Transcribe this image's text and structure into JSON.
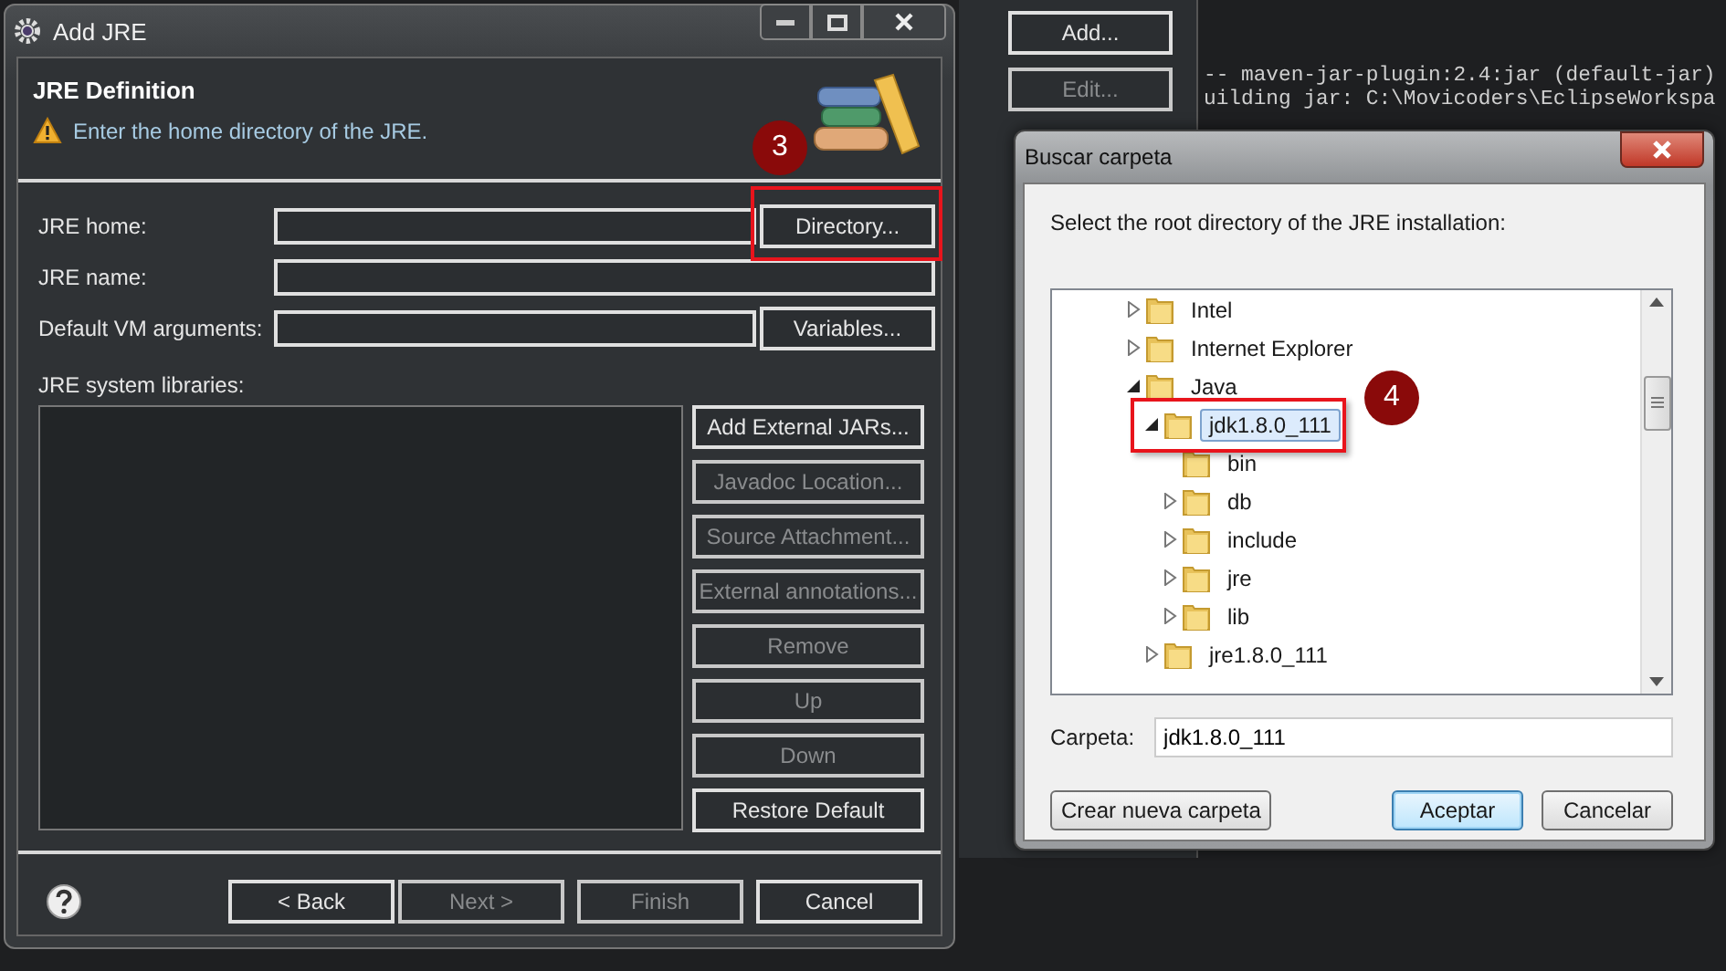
{
  "background": {
    "buttons": [
      {
        "label": "Add...",
        "disabled": false
      },
      {
        "label": "Edit...",
        "disabled": true
      }
    ],
    "console_lines": [
      "-- maven-jar-plugin:2.4:jar (default-jar)",
      "uilding jar: C:\\Movicoders\\EclipseWorkspa"
    ]
  },
  "add_jre": {
    "title": "Add JRE",
    "header_title": "JRE Definition",
    "message": "Enter the home directory of the JRE.",
    "fields": [
      {
        "label": "JRE home:",
        "button": "Directory..."
      },
      {
        "label": "JRE name:"
      },
      {
        "label": "Default VM arguments:",
        "button": "Variables..."
      }
    ],
    "libraries_label": "JRE system libraries:",
    "library_buttons": [
      {
        "label": "Add External JARs...",
        "disabled": false
      },
      {
        "label": "Javadoc Location...",
        "disabled": true
      },
      {
        "label": "Source Attachment...",
        "disabled": true
      },
      {
        "label": "External annotations...",
        "disabled": true
      },
      {
        "label": "Remove",
        "disabled": true
      },
      {
        "label": "Up",
        "disabled": true
      },
      {
        "label": "Down",
        "disabled": true
      },
      {
        "label": "Restore Default",
        "disabled": false
      }
    ],
    "footer_buttons": [
      {
        "label": "< Back",
        "disabled": false
      },
      {
        "label": "Next >",
        "disabled": true
      },
      {
        "label": "Finish",
        "disabled": true
      },
      {
        "label": "Cancel",
        "disabled": false
      }
    ]
  },
  "folder_dialog": {
    "title": "Buscar carpeta",
    "prompt": "Select the root directory of the JRE installation:",
    "tree": [
      {
        "label": "Intel",
        "expandable": true,
        "expanded": false,
        "selected": false
      },
      {
        "label": "Internet Explorer",
        "expandable": true,
        "expanded": false,
        "selected": false
      },
      {
        "label": "Java",
        "expandable": true,
        "expanded": true,
        "selected": false,
        "children": [
          {
            "label": "jdk1.8.0_111",
            "expandable": true,
            "expanded": true,
            "selected": true,
            "children": [
              {
                "label": "bin",
                "expandable": false,
                "selected": false
              },
              {
                "label": "db",
                "expandable": true,
                "expanded": false,
                "selected": false
              },
              {
                "label": "include",
                "expandable": true,
                "expanded": false,
                "selected": false
              },
              {
                "label": "jre",
                "expandable": true,
                "expanded": false,
                "selected": false
              },
              {
                "label": "lib",
                "expandable": true,
                "expanded": false,
                "selected": false
              }
            ]
          },
          {
            "label": "jre1.8.0_111",
            "expandable": true,
            "expanded": false,
            "selected": false
          }
        ]
      }
    ],
    "folder_label": "Carpeta:",
    "folder_value": "jdk1.8.0_111",
    "buttons": [
      {
        "label": "Crear nueva carpeta",
        "default": false
      },
      {
        "label": "Aceptar",
        "default": true
      },
      {
        "label": "Cancelar",
        "default": false
      }
    ]
  },
  "callouts": [
    {
      "label": "3"
    },
    {
      "label": "4"
    }
  ]
}
